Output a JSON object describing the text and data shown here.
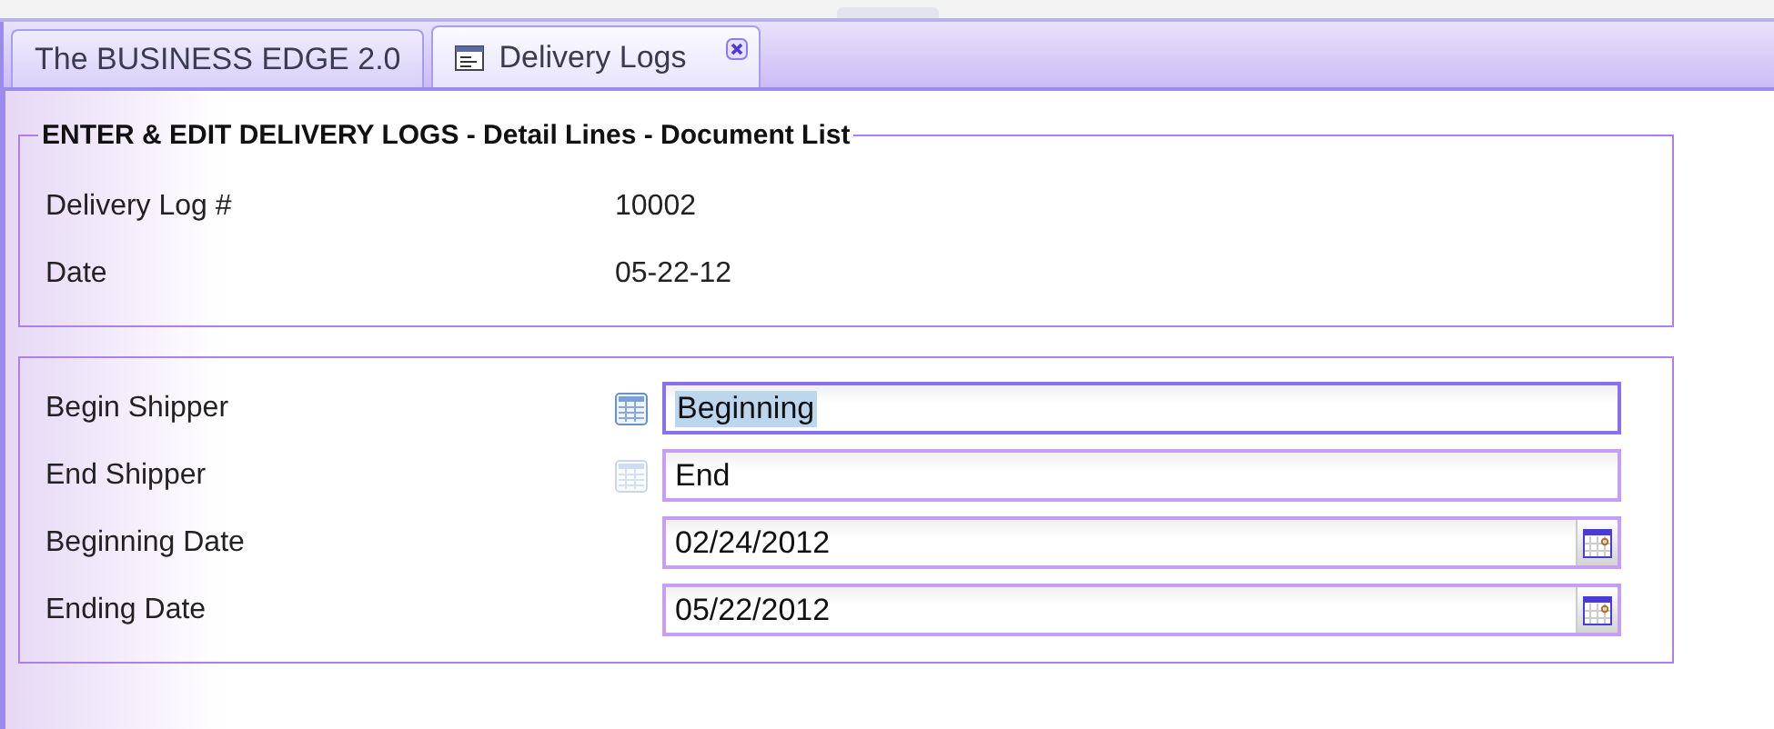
{
  "tabs": [
    {
      "label": "The BUSINESS EDGE 2.0",
      "selected": false,
      "closable": false
    },
    {
      "label": "Delivery Logs",
      "selected": true,
      "closable": true
    }
  ],
  "header_panel": {
    "title": "ENTER & EDIT DELIVERY LOGS - Detail Lines - Document List",
    "fields": [
      {
        "label": "Delivery Log #",
        "value": "10002"
      },
      {
        "label": "Date",
        "value": "05-22-12"
      }
    ]
  },
  "criteria_panel": {
    "fields": [
      {
        "kind": "lookup",
        "label": "Begin Shipper",
        "value": "Beginning",
        "focused": true,
        "lookup_enabled": true
      },
      {
        "kind": "lookup",
        "label": "End Shipper",
        "value": "End",
        "focused": false,
        "lookup_enabled": false
      },
      {
        "kind": "date",
        "label": "Beginning Date",
        "value": "02/24/2012",
        "focused": false
      },
      {
        "kind": "date",
        "label": "Ending Date",
        "value": "05/22/2012",
        "focused": false
      }
    ]
  }
}
